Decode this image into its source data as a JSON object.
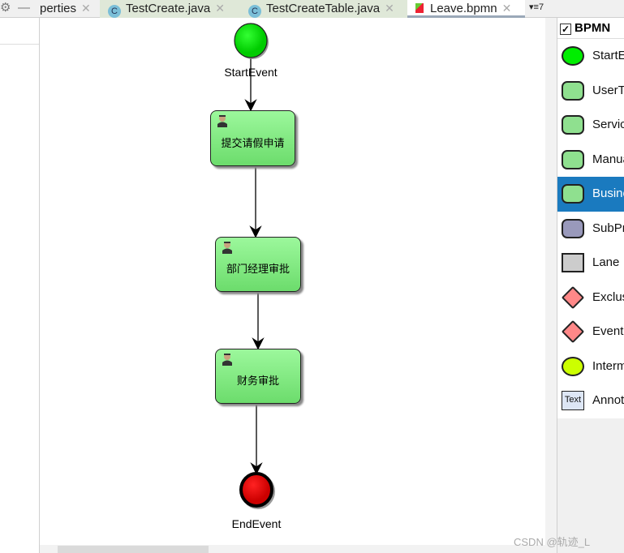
{
  "tabs": [
    {
      "label": "perties"
    },
    {
      "label": "TestCreate.java"
    },
    {
      "label": "TestCreateTable.java"
    },
    {
      "label": "Leave.bpmn",
      "active": true
    }
  ],
  "tab_overflow": "▾≡7",
  "diagram": {
    "start": "StartEvent",
    "end": "EndEvent",
    "tasks": [
      "提交请假申请",
      "部门经理审批",
      "财务审批"
    ]
  },
  "palette": {
    "title": "BPMN",
    "items": [
      {
        "label": "StartEvent",
        "icon": "start-event-icon"
      },
      {
        "label": "UserTask",
        "icon": "user-task-icon"
      },
      {
        "label": "ServiceTask",
        "icon": "service-task-icon"
      },
      {
        "label": "ManualTask",
        "icon": "manual-task-icon"
      },
      {
        "label": "BusinessRuleTask",
        "icon": "business-rule-icon",
        "selected": true
      },
      {
        "label": "SubProcess",
        "icon": "subprocess-icon"
      },
      {
        "label": "Lane",
        "icon": "lane-icon"
      },
      {
        "label": "ExclusiveGateway",
        "icon": "exclusive-gateway-icon"
      },
      {
        "label": "EventGateway",
        "icon": "event-gateway-icon"
      },
      {
        "label": "IntermediateEvent",
        "icon": "intermediate-event-icon"
      },
      {
        "label": "Annotation",
        "icon": "annotation-icon"
      }
    ]
  },
  "watermark": "CSDN @轨迹_L",
  "colors": {
    "selected": "#1a7abf",
    "task": "#8fe88f",
    "start": "#00e000",
    "end": "#e00000"
  }
}
